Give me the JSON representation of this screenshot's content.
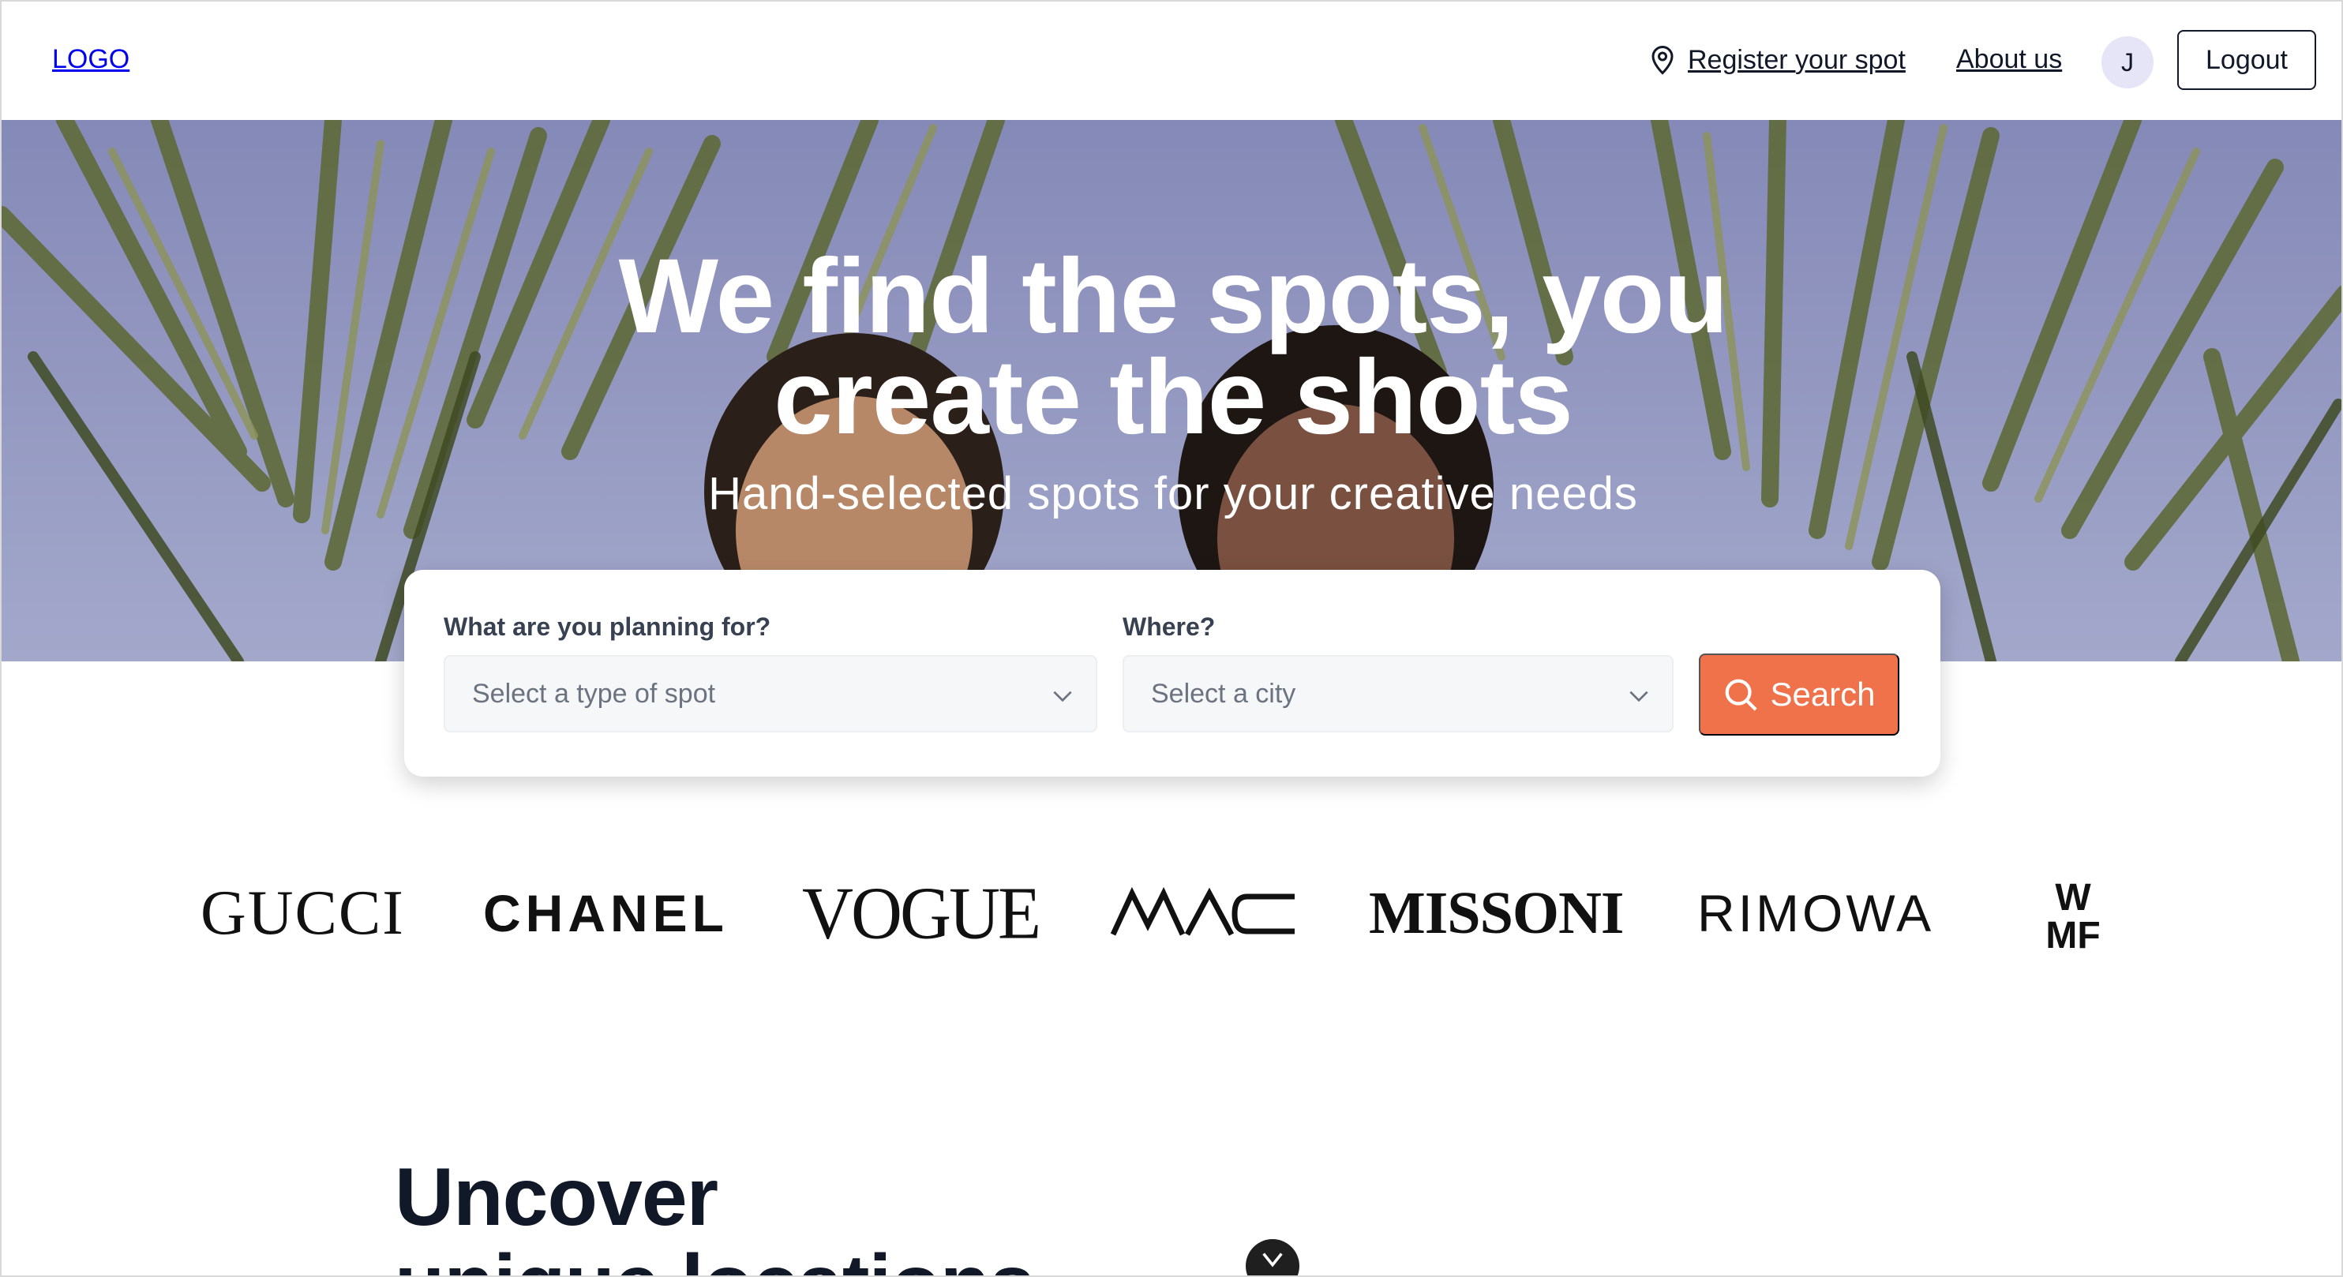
{
  "header": {
    "logo": "LOGO",
    "register_label": "Register your spot",
    "about_label": "About us",
    "avatar_initial": "J",
    "logout_label": "Logout"
  },
  "hero": {
    "title_line1": "We find the spots, you",
    "title_line2": "create the shots",
    "subtitle": "Hand-selected spots for your creative needs"
  },
  "search": {
    "type_label": "What are you planning for?",
    "type_placeholder": "Select a type of spot",
    "city_label": "Where?",
    "city_placeholder": "Select a city",
    "button_label": "Search",
    "accent_color": "#f0724a"
  },
  "brands": [
    "GUCCI",
    "CHANEL",
    "VOGUE",
    "MAC",
    "MISSONI",
    "RIMOWA",
    "WMF"
  ],
  "section": {
    "heading_line1": "Uncover",
    "heading_line2": "unique locations"
  },
  "icons": {
    "register": "map-pin-icon",
    "search": "search-icon",
    "dropdown": "chevron-down-icon",
    "scroll": "chevron-down-icon"
  }
}
